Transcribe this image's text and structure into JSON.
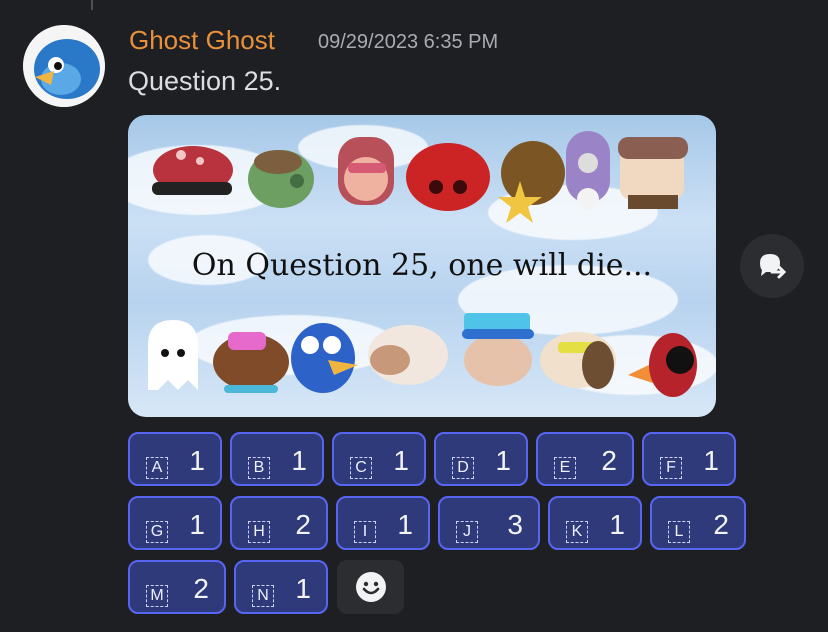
{
  "message": {
    "author": "Ghost Ghost",
    "timestamp": "09/29/2023 6:35 PM",
    "text": "Question 25.",
    "image": {
      "caption": "On Question 25, one will die..."
    }
  },
  "reactions": [
    {
      "letter": "A",
      "count": "1"
    },
    {
      "letter": "B",
      "count": "1"
    },
    {
      "letter": "C",
      "count": "1"
    },
    {
      "letter": "D",
      "count": "1"
    },
    {
      "letter": "E",
      "count": "2"
    },
    {
      "letter": "F",
      "count": "1"
    },
    {
      "letter": "G",
      "count": "1"
    },
    {
      "letter": "H",
      "count": "2"
    },
    {
      "letter": "I",
      "count": "1"
    },
    {
      "letter": "J",
      "count": "3"
    },
    {
      "letter": "K",
      "count": "1"
    },
    {
      "letter": "L",
      "count": "2"
    },
    {
      "letter": "M",
      "count": "2"
    },
    {
      "letter": "N",
      "count": "1"
    }
  ],
  "colors": {
    "accent": "#5865f2",
    "username": "#e8913a",
    "background": "#1e1f22"
  },
  "icons": {
    "share": "share-icon",
    "add_reaction": "smile-icon"
  }
}
